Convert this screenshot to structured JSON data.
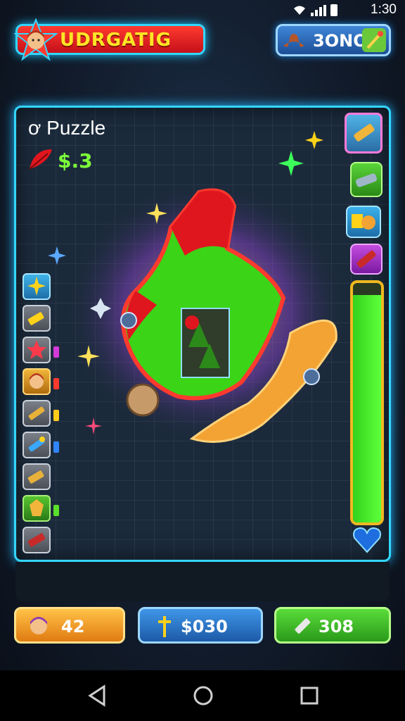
{
  "status_bar": {
    "time": "1:30"
  },
  "header": {
    "title": "UDRGATIG",
    "currency": "3ONO"
  },
  "board": {
    "title": "Puzzle",
    "title_prefix": "ơ",
    "score": "$.3",
    "progress": 0.95
  },
  "left_tools": [
    {
      "icon": "star-icon"
    },
    {
      "icon": "crayon-icon"
    },
    {
      "icon": "red-star-icon"
    },
    {
      "icon": "character-icon"
    },
    {
      "icon": "pencil-icon"
    },
    {
      "icon": "brush-icon"
    },
    {
      "icon": "crayon-icon"
    },
    {
      "icon": "gold-badge-icon"
    },
    {
      "icon": "red-crayon-icon"
    }
  ],
  "right_tools": [
    {
      "icon": "crayon-icon"
    },
    {
      "icon": "bandage-icon"
    },
    {
      "icon": "characters-icon"
    },
    {
      "icon": "red-crayon-icon"
    }
  ],
  "bottom_stats": [
    {
      "value": "42",
      "icon": "avatar-icon"
    },
    {
      "value": "$030",
      "icon": "sword-icon"
    },
    {
      "value": "308",
      "icon": "pencil-icon"
    }
  ],
  "colors": {
    "accent": "#33d6ff",
    "banner": "#e0161f",
    "title_text": "#ffe526",
    "score": "#7dff3a",
    "progress": "#3cdc1e",
    "stat1": "#f5a623",
    "stat2": "#2f86d8",
    "stat3": "#3fbf2c"
  }
}
